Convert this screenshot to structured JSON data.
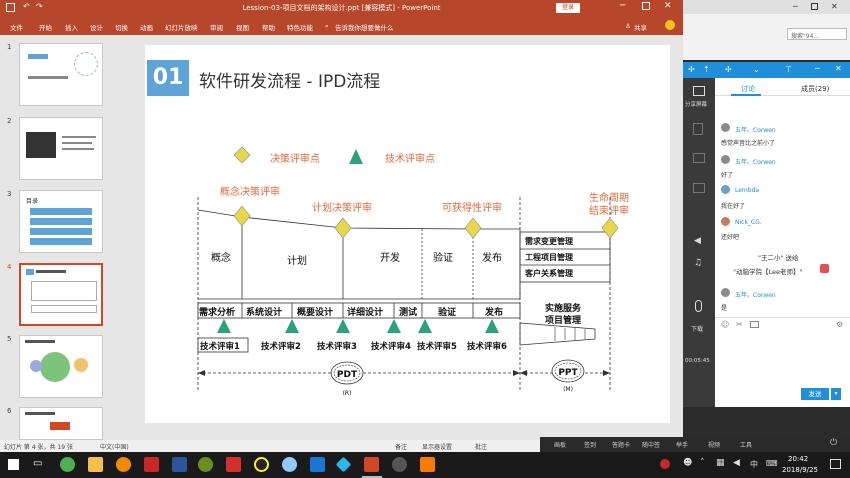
{
  "window": {
    "title": "Lession-03-项目文档的架构设计.ppt [兼容模式] - PowerPoint",
    "login": "登录"
  },
  "ribbon": {
    "tabs": [
      "文件",
      "开始",
      "插入",
      "设计",
      "切换",
      "动画",
      "幻灯片放映",
      "审阅",
      "视图",
      "帮助",
      "特色功能"
    ],
    "tell_me": "告诉我你想要做什么",
    "share": "共享"
  },
  "thumbnails": {
    "numbers": [
      "1",
      "2",
      "3",
      "4",
      "5",
      "6"
    ],
    "thumb3_title": "目录"
  },
  "slide": {
    "number": "01",
    "title": "软件研发流程 - IPD流程",
    "legend": {
      "decision": "决策评审点",
      "technical": "技术评审点"
    },
    "top_labels": {
      "concept_review": "概念决策评审",
      "plan_review": "计划决策评审",
      "availability_review": "可获得性评审",
      "lifecycle_review": "生命周期\n结束评审"
    },
    "phases": [
      "概念",
      "计划",
      "开发",
      "验证",
      "发布"
    ],
    "management": [
      "需求变更管理",
      "工程项目管理",
      "客户关系管理"
    ],
    "steps": [
      "需求分析",
      "系统设计",
      "概要设计",
      "详细设计",
      "测试",
      "验证",
      "发布"
    ],
    "service": [
      "实施服务",
      "项目管理"
    ],
    "tech_reviews": [
      "技术评审1",
      "技术评审2",
      "技术评审3",
      "技术评审4",
      "技术评审5",
      "技术评审6"
    ],
    "pdt": "PDT",
    "pdt_sub": "(R)",
    "ppt": "PPT",
    "ppt_sub": "(M)"
  },
  "statusbar": {
    "slide_info": "幻灯片 第 4 张，共 19 张",
    "language": "中文(中国)",
    "notes": "备注",
    "display": "显示器设置",
    "comments": "批注"
  },
  "browser": {
    "search_placeholder": "搜索\"94..."
  },
  "chat": {
    "tabs": {
      "discussion": "讨论",
      "members": "成员(29)"
    },
    "side_labels": {
      "share": "分享屏幕",
      "download": "下载"
    },
    "messages": [
      {
        "name": "五年。Corwen",
        "text": "感觉声音比之前小了"
      },
      {
        "name": "五年。Corwen",
        "text": "好了"
      },
      {
        "name": "Lembda",
        "text": "我在好了"
      },
      {
        "name": "Nick_CG.",
        "text": "还好吧"
      }
    ],
    "gift": {
      "line1": "\"王二小\" 送给",
      "line2": "\"动脑学院【Lee老师】\""
    },
    "after_gift": {
      "name": "五年。Corwen",
      "text": "是"
    },
    "time": "00:05:45",
    "send": "发送"
  },
  "classbar": {
    "items": [
      "画板",
      "签到",
      "答题卡",
      "随中签",
      "举手",
      "视频",
      "工具"
    ]
  },
  "taskbar": {
    "time": "20:42",
    "date": "2018/9/25",
    "ime": "中"
  },
  "colors": {
    "accent": "#b7472a",
    "slide_blue": "#5ea4d9",
    "diamond": "#e8d74a",
    "triangle": "#2aa37a",
    "review_red": "#e06a3c",
    "chat_blue": "#1e8fd8"
  }
}
